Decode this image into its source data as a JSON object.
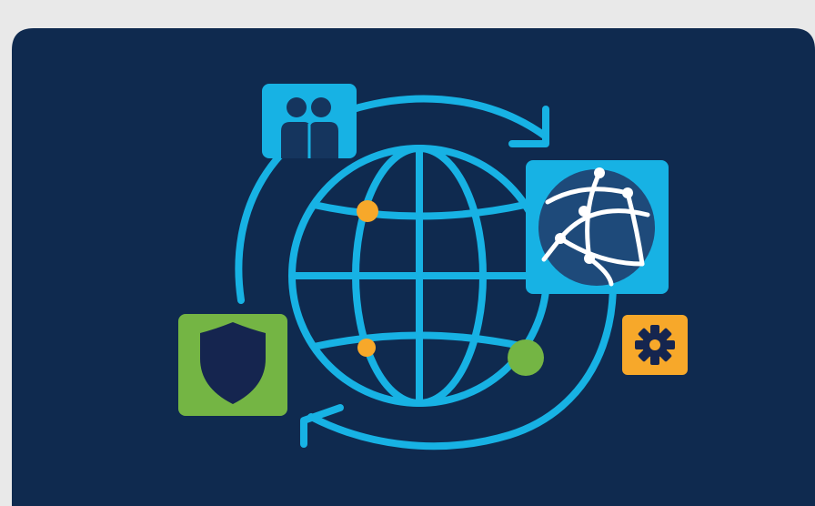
{
  "colors": {
    "page_background": "#e9e9e9",
    "card_background": "#0f2a4f",
    "accent_cyan": "#17b2e4",
    "shield_green": "#74b544",
    "shield_navy": "#15254f",
    "node_orange": "#f7a82a",
    "node_green": "#74b544",
    "network_sphere": "#1e4a7a",
    "gear_tile": "#f7a82a",
    "gear_navy": "#15254f",
    "people_navy": "#15355e"
  },
  "icons": [
    "people-icon",
    "globe-icon",
    "network-sphere-icon",
    "shield-icon",
    "gear-icon",
    "cycle-arrows-icon"
  ]
}
